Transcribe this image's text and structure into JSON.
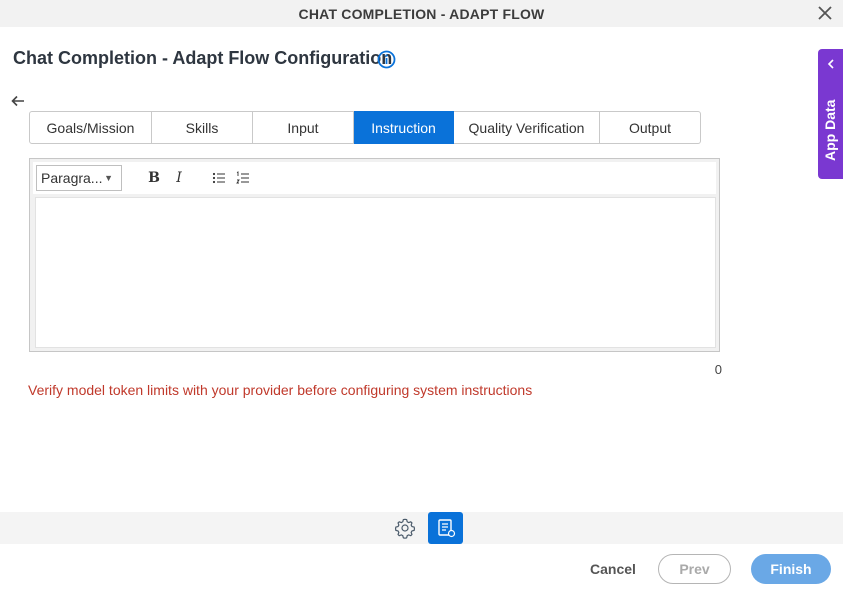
{
  "window": {
    "title": "CHAT COMPLETION - ADAPT FLOW"
  },
  "page": {
    "heading": "Chat Completion - Adapt Flow Configuration"
  },
  "tabs": [
    {
      "label": "Goals/Mission",
      "active": false
    },
    {
      "label": "Skills",
      "active": false
    },
    {
      "label": "Input",
      "active": false
    },
    {
      "label": "Instruction",
      "active": true
    },
    {
      "label": "Quality Verification",
      "active": false
    },
    {
      "label": "Output",
      "active": false
    }
  ],
  "editor": {
    "format_select": "Paragra...",
    "bold_glyph": "B",
    "italic_glyph": "I",
    "content": "",
    "char_count": "0"
  },
  "warning": "Verify model token limits with your provider before configuring system instructions",
  "footer": {
    "cancel": "Cancel",
    "prev": "Prev",
    "finish": "Finish"
  },
  "side_panel": {
    "label": "App Data"
  },
  "colors": {
    "accent": "#0a72d9",
    "side_panel": "#7a38d1",
    "warning": "#c0392b"
  }
}
